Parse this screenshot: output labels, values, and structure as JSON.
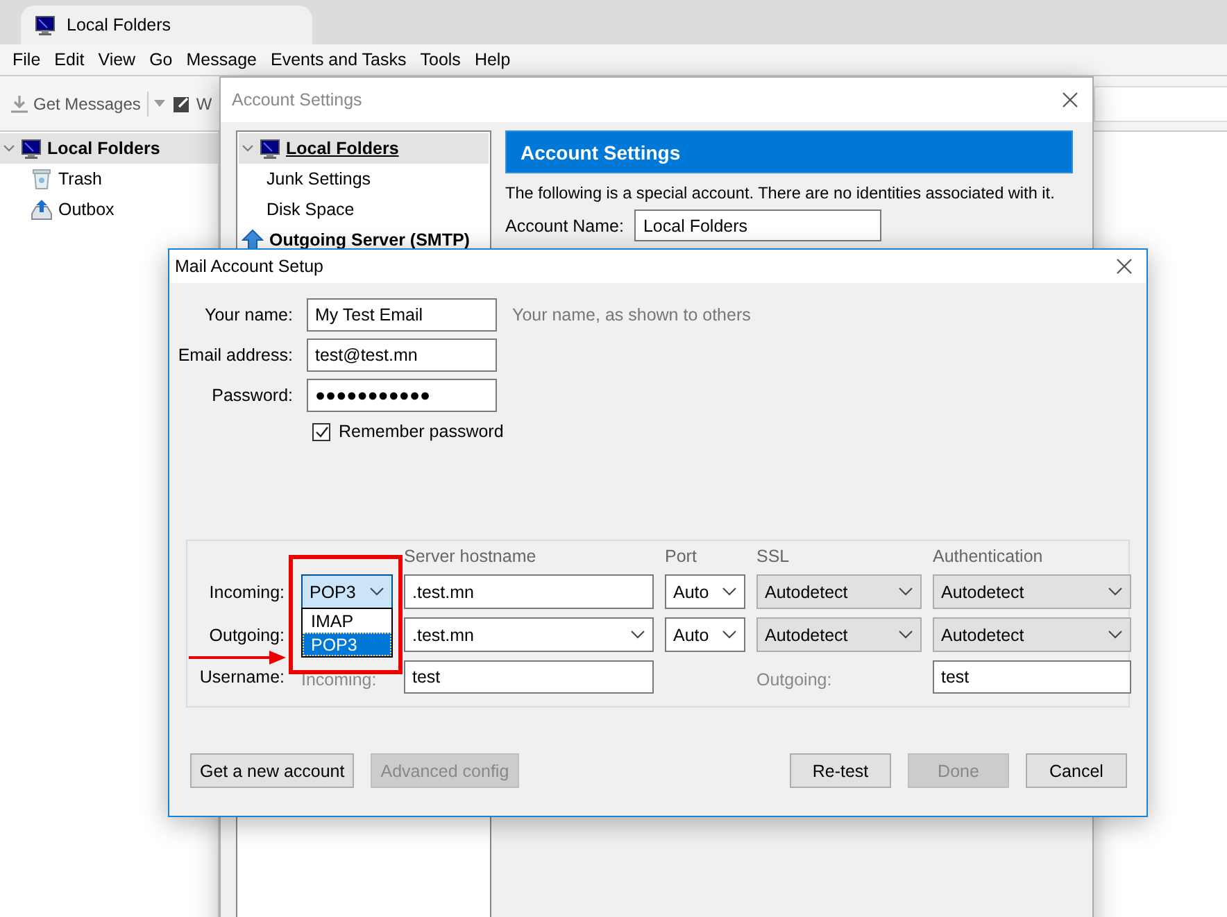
{
  "app_tab": {
    "title": "Local Folders"
  },
  "menu": [
    "File",
    "Edit",
    "View",
    "Go",
    "Message",
    "Events and Tasks",
    "Tools",
    "Help"
  ],
  "toolbar": [
    {
      "kind": "get",
      "label": "Get Messages"
    },
    {
      "kind": "write",
      "label": "W"
    }
  ],
  "folders": [
    {
      "name": "Local Folders",
      "kind": "computer",
      "selected": true,
      "children": [
        {
          "name": "Trash",
          "kind": "trash",
          "selected": false
        },
        {
          "name": "Outbox",
          "kind": "outbox",
          "selected": false
        }
      ]
    }
  ],
  "account_settings": {
    "title": "Account Settings",
    "tree": [
      {
        "label": "Local Folders",
        "kind": "computer",
        "selected": true,
        "children": [
          {
            "label": "Junk Settings",
            "selected": false
          },
          {
            "label": "Disk Space",
            "selected": false
          }
        ]
      },
      {
        "label": "Outgoing Server (SMTP)",
        "kind": "server",
        "selected": false
      }
    ],
    "heading": "Account Settings",
    "description": "The following is a special account. There are no identities associated with it.",
    "account_name": {
      "label": "Account Name:",
      "value": "Local Folders"
    }
  },
  "mail_setup": {
    "title": "Mail Account Setup",
    "fields": [
      {
        "label": "Your name:",
        "value": "My Test Email",
        "hint": "Your name, as shown to others"
      },
      {
        "label": "Email address:",
        "value": "test@test.mn"
      },
      {
        "label": "Password:",
        "value": "●●●●●●●●●●●"
      }
    ],
    "remember": {
      "label": "Remember password",
      "checked": true
    },
    "columns": [
      "Server hostname",
      "Port",
      "SSL",
      "Authentication"
    ],
    "incoming": {
      "label": "Incoming:",
      "protocol": "POP3",
      "open": true,
      "hostname": ".test.mn",
      "port": "Auto",
      "ssl": "Autodetect",
      "auth": "Autodetect"
    },
    "outgoing": {
      "label": "Outgoing:",
      "hostname": ".test.mn",
      "port": "Auto",
      "ssl": "Autodetect",
      "auth": "Autodetect"
    },
    "protocol_menu": [
      {
        "label": "IMAP",
        "selected": false
      },
      {
        "label": "POP3",
        "selected": true
      }
    ],
    "username": {
      "label": "Username:",
      "incoming_label": "Incoming:",
      "incoming": "test",
      "outgoing_label": "Outgoing:",
      "outgoing": "test"
    },
    "buttons_left": [
      {
        "label": "Get a new account",
        "disabled": false
      },
      {
        "label": "Advanced config",
        "disabled": true
      }
    ],
    "buttons_right": [
      {
        "label": "Re-test",
        "disabled": false
      },
      {
        "label": "Done",
        "disabled": true
      },
      {
        "label": "Cancel",
        "disabled": false
      }
    ]
  }
}
